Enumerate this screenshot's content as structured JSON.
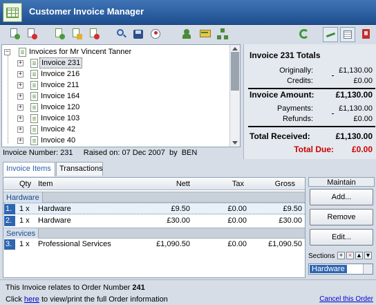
{
  "app": {
    "title": "Customer Invoice Manager"
  },
  "toolbar": {
    "buttons": [
      "new-invoice-icon",
      "delete-invoice-icon",
      "add-item-icon",
      "edit-item-icon",
      "delete-item-icon",
      "search-icon",
      "save-icon",
      "print-icon",
      "add-customer-icon",
      "card-icon",
      "network-icon",
      "refresh-icon",
      "collapse-icon",
      "columns-icon",
      "exit-icon"
    ]
  },
  "tree": {
    "root_label": "Invoices for Mr Vincent Tanner",
    "items": [
      "Invoice 231",
      "Invoice 216",
      "Invoice 211",
      "Invoice 164",
      "Invoice 120",
      "Invoice 103",
      "Invoice 42",
      "Invoice 40"
    ],
    "selected": "Invoice 231"
  },
  "status": {
    "invoice_number_label": "Invoice Number:",
    "invoice_number": "231",
    "raised_label": "Raised on:",
    "raised_on": "07 Dec 2007",
    "by_label": "by",
    "by": "BEN"
  },
  "totals": {
    "title": "Invoice 231 Totals",
    "originally_label": "Originally:",
    "originally": "£1,130.00",
    "credits_label": "Credits:",
    "credits": "£0.00",
    "invoice_amount_label": "Invoice Amount:",
    "invoice_amount": "£1,130.00",
    "payments_label": "Payments:",
    "payments": "£1,130.00",
    "refunds_label": "Refunds:",
    "refunds": "£0.00",
    "total_received_label": "Total Received:",
    "total_received": "£1,130.00",
    "total_due_label": "Total Due:",
    "total_due": "£0.00",
    "due_color": "#cc0000"
  },
  "tabs": [
    {
      "label": "Invoice Items",
      "active": true
    },
    {
      "label": "Transactions",
      "active": false
    }
  ],
  "grid": {
    "columns": {
      "qty": "Qty",
      "item": "Item",
      "nett": "Nett",
      "tax": "Tax",
      "gross": "Gross"
    },
    "sections": [
      {
        "name": "Hardware",
        "rows": [
          {
            "num": "1.",
            "qty": "1 x",
            "item": "Hardware",
            "nett": "£9.50",
            "tax": "£0.00",
            "gross": "£9.50"
          },
          {
            "num": "2.",
            "qty": "1 x",
            "item": "Hardware",
            "nett": "£30.00",
            "tax": "£0.00",
            "gross": "£30.00"
          }
        ]
      },
      {
        "name": "Services",
        "rows": [
          {
            "num": "3.",
            "qty": "1 x",
            "item": "Professional Services",
            "nett": "£1,090.50",
            "tax": "£0.00",
            "gross": "£1,090.50"
          }
        ]
      }
    ]
  },
  "maintain": {
    "title": "Maintain",
    "add": "Add...",
    "remove": "Remove",
    "edit": "Edit...",
    "sections_label": "Sections",
    "section_value": "Hardware"
  },
  "footer": {
    "order_text": "This Invoice relates to Order Number",
    "order_number": "241",
    "click": "Click",
    "here": "here",
    "view_text": "to view/print the full Order information",
    "cancel": "Cancel this Order"
  }
}
